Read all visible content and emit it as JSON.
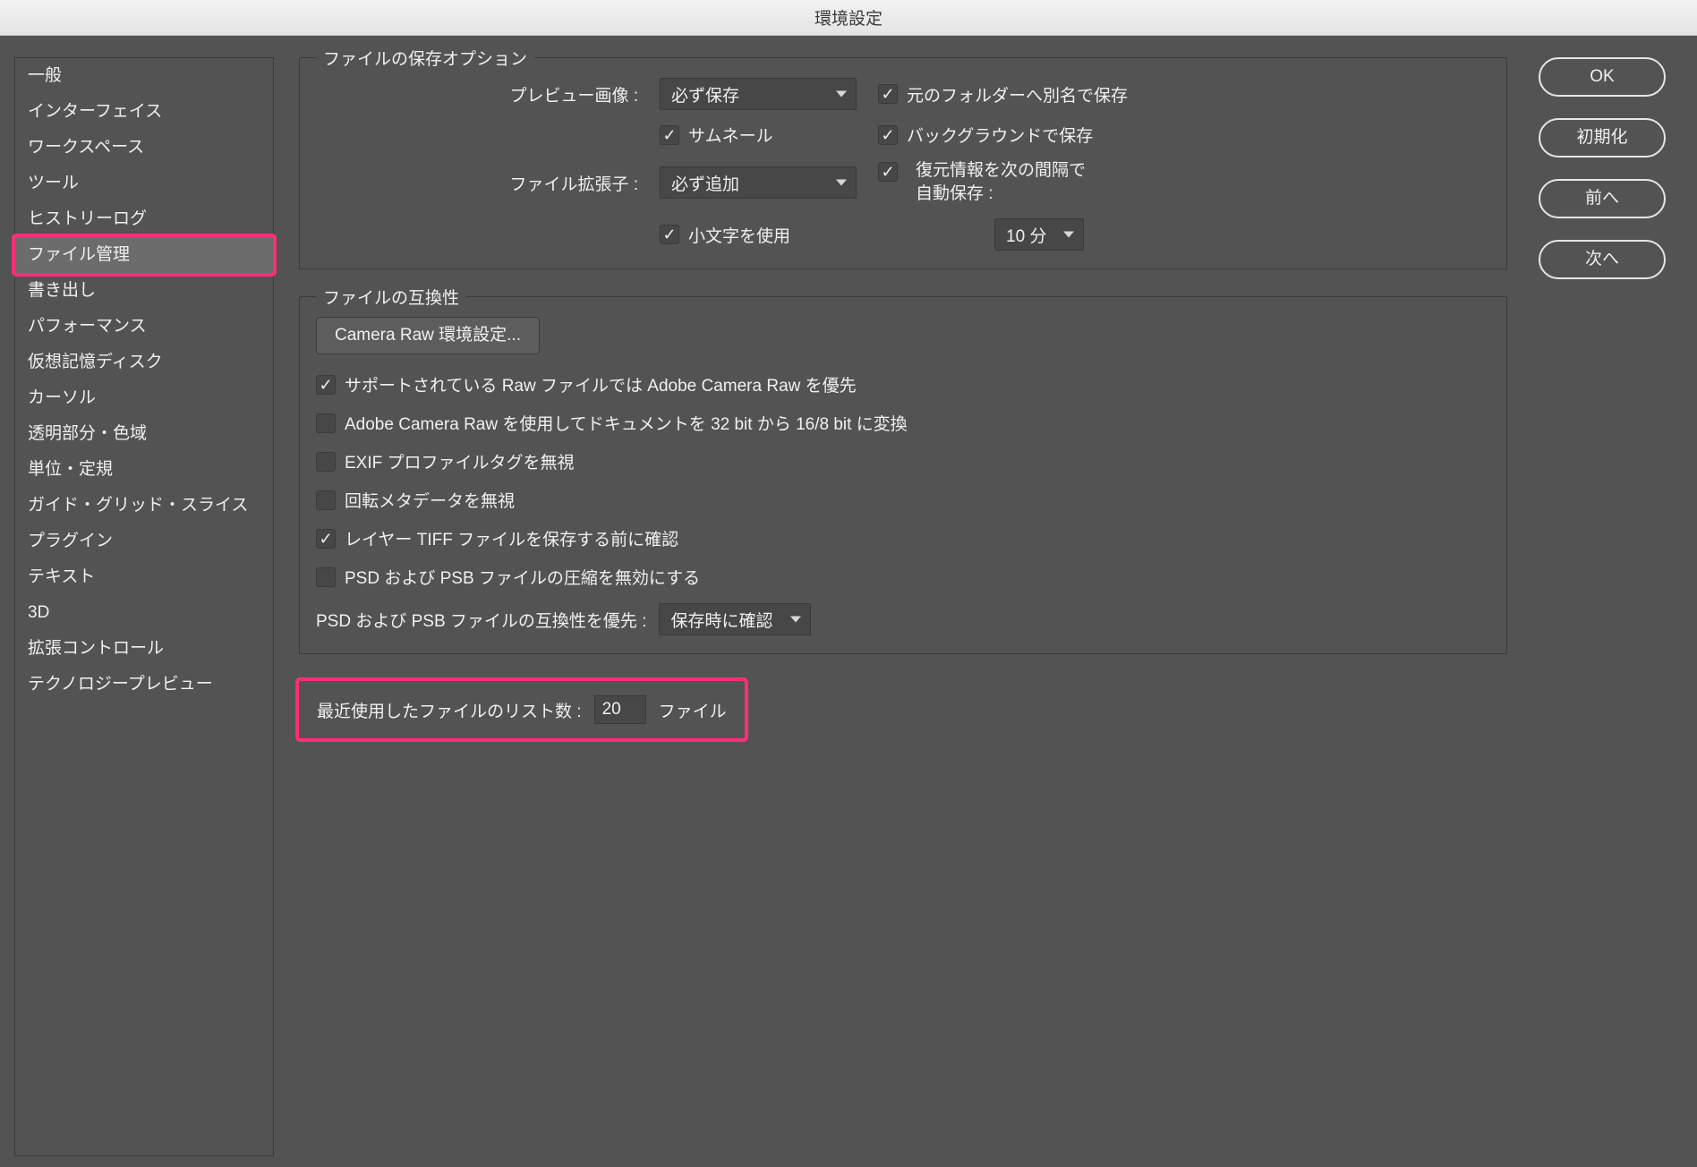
{
  "window": {
    "title": "環境設定"
  },
  "sidebar": {
    "items": [
      {
        "label": "一般"
      },
      {
        "label": "インターフェイス"
      },
      {
        "label": "ワークスペース"
      },
      {
        "label": "ツール"
      },
      {
        "label": "ヒストリーログ"
      },
      {
        "label": "ファイル管理"
      },
      {
        "label": "書き出し"
      },
      {
        "label": "パフォーマンス"
      },
      {
        "label": "仮想記憶ディスク"
      },
      {
        "label": "カーソル"
      },
      {
        "label": "透明部分・色域"
      },
      {
        "label": "単位・定規"
      },
      {
        "label": "ガイド・グリッド・スライス"
      },
      {
        "label": "プラグイン"
      },
      {
        "label": "テキスト"
      },
      {
        "label": "3D"
      },
      {
        "label": "拡張コントロール"
      },
      {
        "label": "テクノロジープレビュー"
      }
    ],
    "selected_index": 5,
    "highlight_index": 5
  },
  "buttons": {
    "ok": "OK",
    "reset": "初期化",
    "prev": "前へ",
    "next": "次へ"
  },
  "save_options": {
    "title": "ファイルの保存オプション",
    "preview_label": "プレビュー画像 :",
    "preview_value": "必ず保存",
    "thumbnail_label": "サムネール",
    "extension_label": "ファイル拡張子 :",
    "extension_value": "必ず追加",
    "lowercase_label": "小文字を使用",
    "save_as_alias_label": "元のフォルダーへ別名で保存",
    "background_save_label": "バックグラウンドで保存",
    "autosave_label_line1": "復元情報を次の間隔で",
    "autosave_label_line2": "自動保存 :",
    "autosave_interval": "10 分"
  },
  "compat": {
    "title": "ファイルの互換性",
    "cameraraw_btn": "Camera Raw 環境設定...",
    "prefer_acr": "サポートされている Raw ファイルでは Adobe Camera Raw を優先",
    "acr_32bit": "Adobe Camera Raw を使用してドキュメントを 32 bit から 16/8 bit に変換",
    "ignore_exif": "EXIF プロファイルタグを無視",
    "ignore_rotation": "回転メタデータを無視",
    "ask_tiff": "レイヤー TIFF ファイルを保存する前に確認",
    "disable_psd_comp": "PSD および PSB ファイルの圧縮を無効にする",
    "psd_compat_label": "PSD および PSB ファイルの互換性を優先 :",
    "psd_compat_value": "保存時に確認"
  },
  "recent": {
    "label": "最近使用したファイルのリスト数 :",
    "value": "20",
    "unit": "ファイル"
  }
}
